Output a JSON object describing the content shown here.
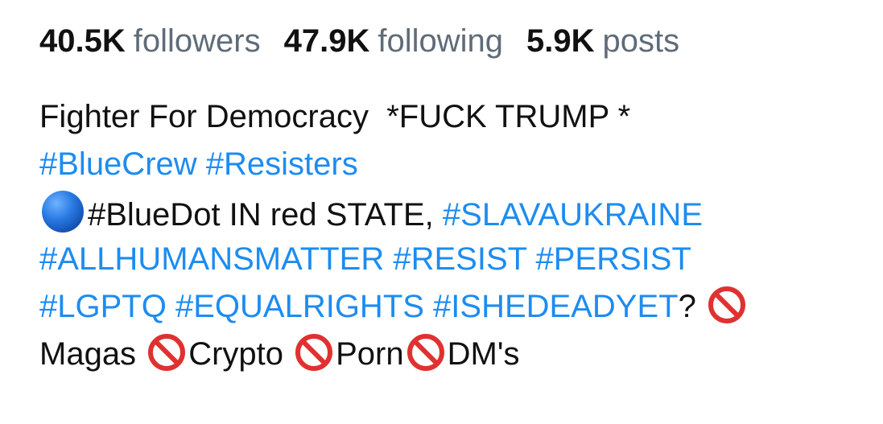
{
  "stats": {
    "followers": {
      "count": "40.5K",
      "label": "followers"
    },
    "following": {
      "count": "47.9K",
      "label": "following"
    },
    "posts": {
      "count": "5.9K",
      "label": "posts"
    }
  },
  "bio": {
    "line1": "Fighter For Democracy  *FUCK TRUMP *",
    "line2": {
      "tag1": "#BlueCrew",
      "tag2": "#Resisters"
    },
    "line3": {
      "icon": "blue-circle-icon",
      "text": "#BlueDot IN red STATE, ",
      "tag": "#SLAVAUKRAINE"
    },
    "line4": {
      "tag1": "#ALLHUMANSMATTER",
      "tag2": "#RESIST",
      "tag3": "#PERSIST"
    },
    "line5": {
      "tag1": "#LGPTQ",
      "tag2": "#EQUALRIGHTS",
      "tag3": "#ISHEDEADYET",
      "suffix": "?",
      "icon": "prohibited-icon"
    },
    "line6": {
      "item1": "Magas",
      "item2": "Crypto",
      "item3": "Porn",
      "item4": "DM's",
      "icon": "prohibited-icon"
    }
  },
  "colors": {
    "hashtag": "#1d8cf0",
    "stat_label": "#5f6b78",
    "text": "#111111",
    "prohibited": "#e03131",
    "blue_dot": "#1e6fd9"
  }
}
